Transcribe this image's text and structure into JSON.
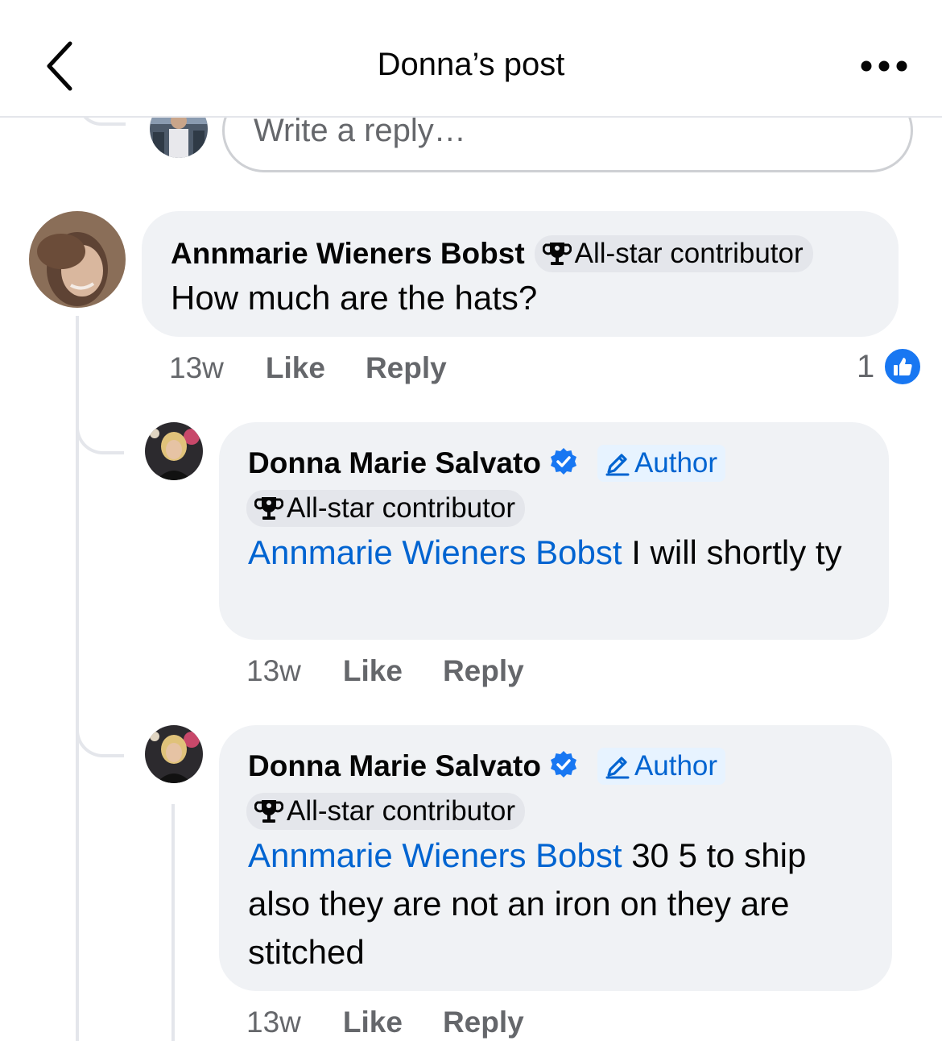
{
  "header": {
    "title": "Donna’s post",
    "back_icon": "chevron-left-icon",
    "more_icon": "more-horizontal-icon"
  },
  "composer": {
    "placeholder": "Write a reply…"
  },
  "comments": [
    {
      "author": "Annmarie Wieners Bobst",
      "badge": "All-star contributor",
      "text": "How much are the hats?",
      "time": "13w",
      "like_label": "Like",
      "reply_label": "Reply",
      "reaction_count": "1"
    },
    {
      "author": "Donna Marie Salvato",
      "verified": true,
      "author_label": "Author",
      "badge": "All-star contributor",
      "mention": "Annmarie Wieners Bobst",
      "text": " I will shortly ty",
      "time": "13w",
      "like_label": "Like",
      "reply_label": "Reply"
    },
    {
      "author": "Donna Marie Salvato",
      "verified": true,
      "author_label": "Author",
      "badge": "All-star contributor",
      "mention": "Annmarie Wieners Bobst",
      "text": " 30 5 to ship also they are not an iron on they are stitched",
      "time": "13w",
      "like_label": "Like",
      "reply_label": "Reply"
    }
  ],
  "colors": {
    "link": "#0064d1",
    "like_blue": "#1877f2",
    "bubble": "#f0f2f5",
    "secondary_text": "#65676b"
  }
}
